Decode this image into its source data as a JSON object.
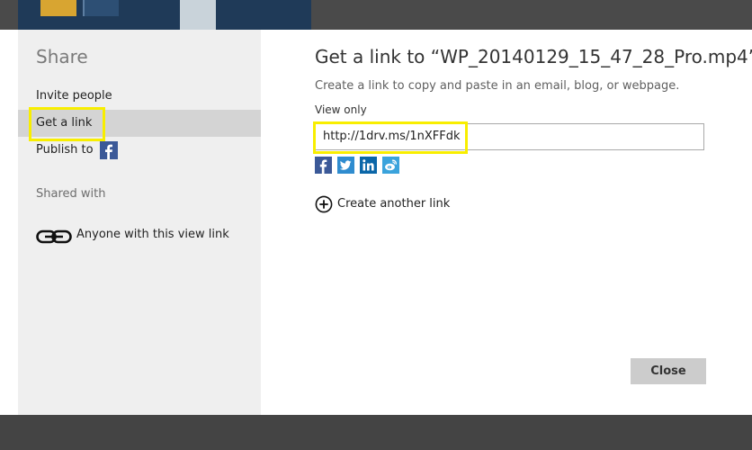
{
  "sidebar": {
    "title": "Share",
    "items": [
      {
        "label": "Invite people"
      },
      {
        "label": "Get a link"
      },
      {
        "label": "Publish to"
      }
    ],
    "shared_with_label": "Shared with",
    "permission": {
      "label": "Anyone with this view link",
      "icon": "link-icon"
    }
  },
  "main": {
    "title": "Get a link to “WP_20140129_15_47_28_Pro.mp4”",
    "description": "Create a link to copy and paste in an email, blog, or webpage.",
    "view_label": "View only",
    "url": "http://1drv.ms/1nXFFdk",
    "share_icons": [
      "facebook-icon",
      "twitter-icon",
      "linkedin-icon",
      "weibo-icon"
    ],
    "create_link_label": "Create another link",
    "close_label": "Close"
  },
  "colors": {
    "highlight": "#f8ee00",
    "facebook": "#3b5998",
    "twitter": "#2f8ccf",
    "linkedin": "#0a66a8",
    "weibo": "#3aa3dc",
    "sidebar_bg": "#efefef",
    "active_item_bg": "#d4d4d4",
    "close_button_bg": "#cccccc"
  }
}
